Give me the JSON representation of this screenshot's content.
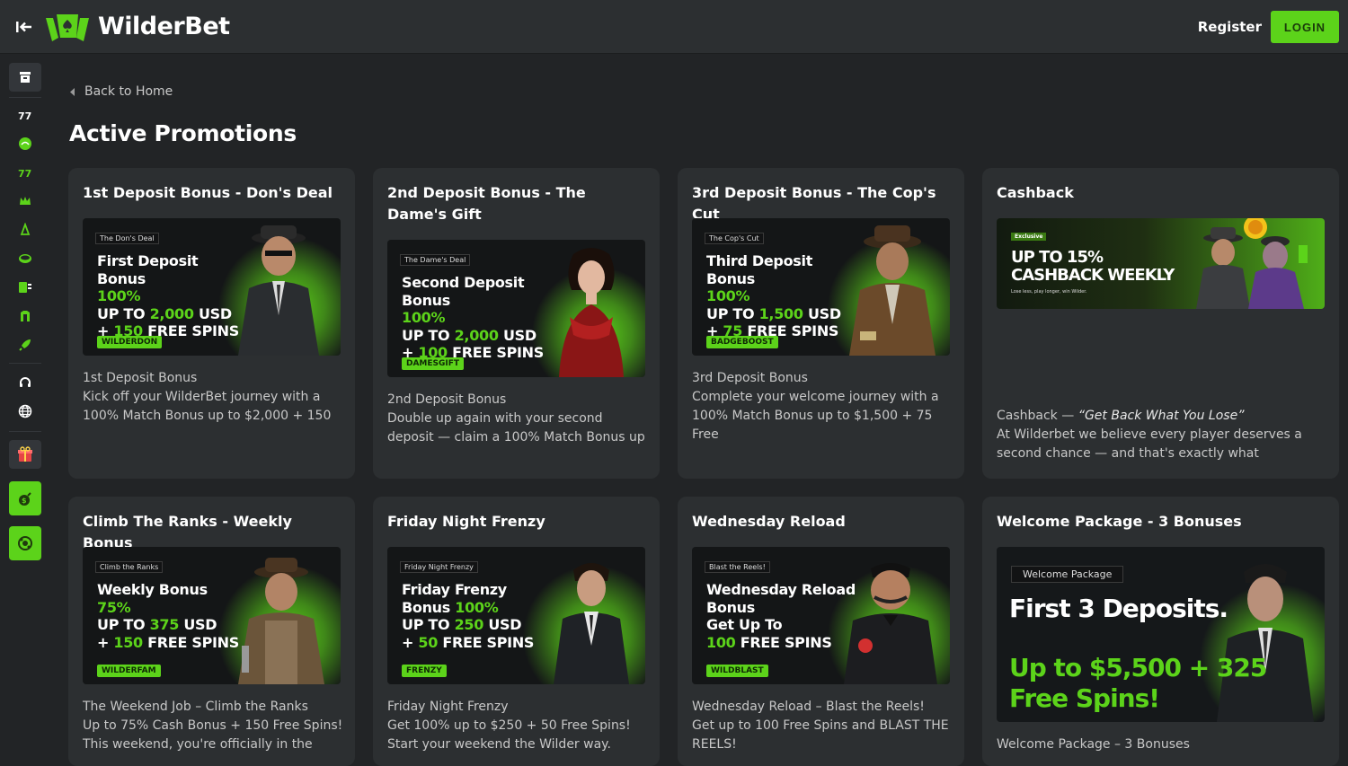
{
  "brand": {
    "name": "WilderBet"
  },
  "header": {
    "register_label": "Register",
    "login_label": "LOGIN"
  },
  "sidebar": {
    "items": [
      "casino-icon",
      "sports-icon",
      "live-icon",
      "virtual-icon",
      "crown-icon",
      "esports-icon",
      "bets-icon",
      "slots-icon",
      "bonus-icon",
      "rocket-icon",
      "support-icon",
      "language-icon",
      "gift-icon",
      "bomb-icon",
      "spin-icon"
    ]
  },
  "nav": {
    "back_label": "Back to Home"
  },
  "page": {
    "title": "Active Promotions"
  },
  "colors": {
    "accent": "#5cd31a",
    "card": "#2c2f31",
    "bg": "#222426"
  },
  "promotions": [
    {
      "title": "1st Deposit Bonus - Don's Deal",
      "tag": "The Don's Deal",
      "line1": "First Deposit Bonus",
      "line2": "100%",
      "line3a": "UP TO ",
      "line3b": "2,000",
      "line3c": " USD",
      "line4a": "+ ",
      "line4b": "150",
      "line4c": " FREE SPINS",
      "code": "WILDERDON",
      "desc1": "1st Deposit Bonus",
      "desc2": "Kick off your WilderBet journey with a 100% Match Bonus up to $2,000 + 150"
    },
    {
      "title": "2nd Deposit Bonus - The Dame's Gift",
      "tag": "The Dame's Deal",
      "line1": "Second Deposit Bonus",
      "line2": "100%",
      "line3a": "UP TO ",
      "line3b": "2,000",
      "line3c": " USD",
      "line4a": "+ ",
      "line4b": "100",
      "line4c": " FREE SPINS",
      "code": "DAMESGIFT",
      "desc1": "2nd Deposit Bonus",
      "desc2": "Double up again with your second deposit — claim a 100% Match Bonus up"
    },
    {
      "title": "3rd Deposit Bonus - The Cop's Cut",
      "tag": "The Cop's Cut",
      "line1": "Third Deposit Bonus",
      "line2": "100%",
      "line3a": "UP TO ",
      "line3b": "1,500",
      "line3c": " USD",
      "line4a": "+ ",
      "line4b": "75",
      "line4c": " FREE SPINS",
      "code": "BADGEBOOST",
      "desc1": "3rd Deposit Bonus",
      "desc2": "Complete your welcome journey with a 100% Match Bonus up to $1,500 + 75 Free"
    },
    {
      "title": "Cashback",
      "tag": "Exclusive",
      "line1": "UP TO 15%",
      "line2": "CASHBACK WEEKLY",
      "line3": "Lose less, play longer, win Wilder.",
      "desc1a": "Cashback — ",
      "desc1b": "“Get Back What You Lose”",
      "desc2": "At Wilderbet we believe every player deserves a second chance — and that's exactly what"
    },
    {
      "title": "Climb The Ranks - Weekly Bonus",
      "tag": "Climb the Ranks",
      "line1": "Weekly Bonus",
      "line2": "75%",
      "line3a": "UP TO ",
      "line3b": "375",
      "line3c": " USD",
      "line4a": "+ ",
      "line4b": "150",
      "line4c": " FREE SPINS",
      "code": "WILDERFAM",
      "desc1": "The Weekend Job – Climb the Ranks",
      "desc2": "Up to 75% Cash Bonus + 150 Free Spins! This weekend, you're officially in the"
    },
    {
      "title": "Friday Night Frenzy",
      "tag": "Friday Night Frenzy",
      "line1": "Friday Frenzy",
      "line1b": "Bonus ",
      "line2": "100%",
      "line3a": "UP TO ",
      "line3b": "250",
      "line3c": " USD",
      "line4a": "+ ",
      "line4b": "50",
      "line4c": " FREE SPINS",
      "code": "FRENZY",
      "desc1": "Friday Night Frenzy",
      "desc2": "Get 100% up to $250 + 50 Free Spins! Start your weekend the Wilder way."
    },
    {
      "title": "Wednesday Reload",
      "tag": "Blast the Reels!",
      "line1": "Wednesday Reload",
      "line1b": "Bonus",
      "line2": "Get Up To",
      "line3b": "100",
      "line3c": " FREE SPINS",
      "code": "WILDBLAST",
      "desc1": "Wednesday Reload – Blast the Reels!",
      "desc2": "Get up to 100 Free Spins and BLAST THE REELS!"
    },
    {
      "title": "Welcome Package - 3 Bonuses",
      "tag": "Welcome Package",
      "line1": "First 3 Deposits.",
      "line2": "Up to $5,500 + 325",
      "line3": "Free Spins!",
      "desc1": "Welcome Package – 3 Bonuses"
    }
  ]
}
